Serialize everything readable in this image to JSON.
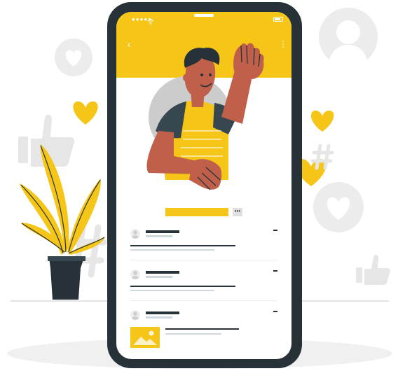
{
  "colors": {
    "accent": "#f5c518",
    "dark": "#263238",
    "skin": "#c1604a",
    "muted": "#e6e6e6",
    "background": "#ffffff"
  },
  "status_bar": {
    "signal_glyph": "●●●●● ",
    "wifi_icon": "wifi-icon",
    "battery_icon": "battery-icon"
  },
  "header": {
    "back_glyph": "‹",
    "menu_glyph": "⋮"
  },
  "profile": {
    "more_glyph": "•••"
  },
  "feed": {
    "post_count": 3,
    "post_with_image_index": 2
  },
  "decorations": {
    "icons": [
      "heart-icon",
      "user-icon",
      "like-icon",
      "hashtag-icon",
      "plant-icon"
    ]
  }
}
